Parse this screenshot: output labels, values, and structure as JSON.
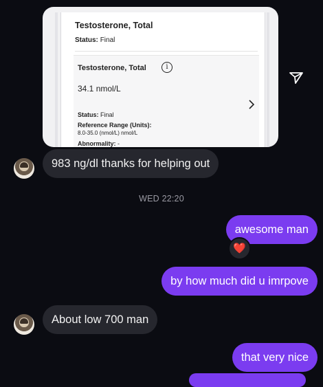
{
  "lab_card": {
    "title": "Testosterone, Total",
    "status_label": "Status:",
    "status_value": "Final",
    "result_title": "Testosterone, Total",
    "info_icon": "info-icon",
    "result_value": "34.1 nmol/L",
    "result_status_label": "Status:",
    "result_status_value": "Final",
    "reference_label": "Reference Range (Units):",
    "reference_value": "8.0-35.0 (nmol/L) nmol/L",
    "abnormality_label": "Abnormality:",
    "abnormality_value": "-"
  },
  "messages": [
    {
      "sender": "other",
      "text": "983 ng/dl thanks for helping out"
    },
    {
      "sender": "me",
      "text": "awesome man",
      "reaction": "❤️"
    },
    {
      "sender": "me",
      "text": "by how much did u imrpove"
    },
    {
      "sender": "other",
      "text": "About low 700 man"
    },
    {
      "sender": "me",
      "text": "that very nice"
    }
  ],
  "timestamp": "WED 22:20",
  "icons": {
    "share": "paper-plane-icon",
    "chevron": "chevron-right-icon"
  },
  "colors": {
    "background": "#0b0c12",
    "incoming_bubble": "#26272e",
    "outgoing_bubble": "#7b3cf0"
  }
}
